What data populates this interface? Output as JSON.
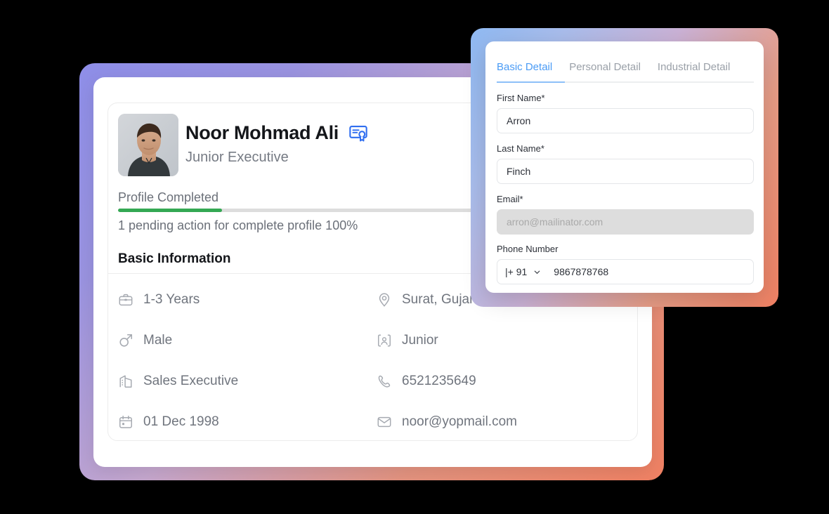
{
  "profile": {
    "name": "Noor Mohmad Ali",
    "role": "Junior Executive",
    "verified_badge_icon": "certificate-icon",
    "avatar_icon": "user-photo",
    "progress": {
      "label": "Profile Completed",
      "percent": 20,
      "fill_color": "#34a853",
      "track_color": "#dddddd",
      "note": "1 pending action for complete profile 100%"
    },
    "basic_information": {
      "title": "Basic Information",
      "items": [
        {
          "icon": "briefcase-icon",
          "value": "1-3 Years"
        },
        {
          "icon": "location-pin-icon",
          "value": "Surat, Gujarat"
        },
        {
          "icon": "male-gender-icon",
          "value": "Male"
        },
        {
          "icon": "id-card-icon",
          "value": "Junior"
        },
        {
          "icon": "building-icon",
          "value": "Sales Executive"
        },
        {
          "icon": "phone-icon",
          "value": "6521235649"
        },
        {
          "icon": "calendar-icon",
          "value": "01 Dec 1998"
        },
        {
          "icon": "envelope-icon",
          "value": "noor@yopmail.com"
        }
      ]
    }
  },
  "detail_panel": {
    "tabs": [
      {
        "label": "Basic Detail",
        "active": true
      },
      {
        "label": "Personal Detail",
        "active": false
      },
      {
        "label": "Industrial Detail",
        "active": false
      }
    ],
    "active_tab_color": "#4a9bf5",
    "fields": {
      "first_name": {
        "label": "First Name*",
        "value": "Arron"
      },
      "last_name": {
        "label": "Last Name*",
        "value": "Finch"
      },
      "email": {
        "label": "Email*",
        "value": "",
        "placeholder": "arron@mailinator.com",
        "disabled": true
      },
      "phone": {
        "label": "Phone Number",
        "country_code": "|+ 91",
        "value": "9867878768",
        "chevron_icon": "chevron-down-icon"
      }
    }
  },
  "theme": {
    "card_gradient_start": "#8e8ee8",
    "card_gradient_end": "#f08163",
    "detail_gradient_start": "#8fb9f2",
    "detail_gradient_end": "#f08163",
    "background": "#000000"
  }
}
